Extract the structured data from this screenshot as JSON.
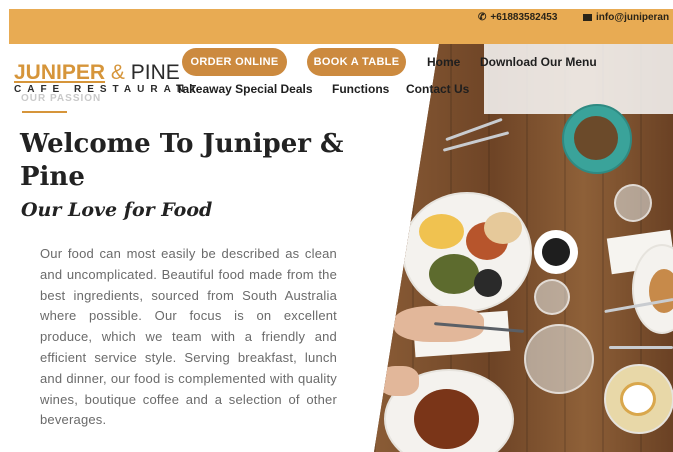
{
  "topbar": {
    "phone": "+61883582453",
    "email": "info@juniperan",
    "color": "#e8ab53"
  },
  "logo": {
    "word1": "JUNIPER",
    "amp": "&",
    "word2": "PINE",
    "tagline": "CAFE RESTAURANT"
  },
  "buttons": {
    "order_online": "ORDER ONLINE",
    "book_table": "BOOK A TABLE",
    "accent": "#cc8a3f"
  },
  "nav": {
    "home": "Home",
    "download_menu": "Download Our Menu",
    "takeaway": "Takeaway Special Deals",
    "functions": "Functions",
    "contact": "Contact Us"
  },
  "section": {
    "eyebrow": "OUR PASSION",
    "title": "Welcome To Juniper & Pine",
    "subtitle": "Our Love for Food",
    "body": "Our food can most easily be described as clean and uncomplicated. Beautiful food made from the best ingredients, sourced from South Australia where possible. Our focus is on excellent produce, which we team with a friendly and efficient service style. Serving breakfast, lunch and dinner, our food is complemented with quality wines, boutique coffee and a selection of other beverages."
  },
  "icons": {
    "phone": "phone-icon",
    "email": "envelope-icon"
  }
}
